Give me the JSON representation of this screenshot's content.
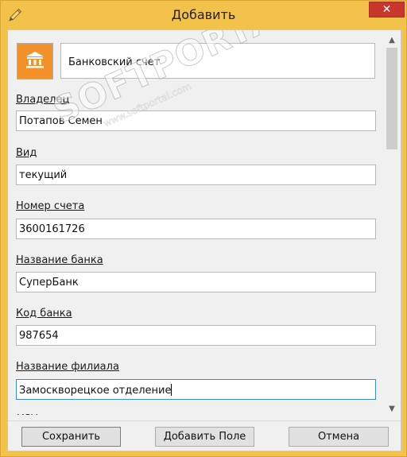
{
  "window": {
    "title": "Добавить",
    "title_icon": "pencil-icon",
    "close_glyph": "✕",
    "accent_color": "#f3c24a",
    "close_color": "#c7372d"
  },
  "record_type": {
    "icon": "bank-icon",
    "icon_color": "#f3912b",
    "name": "Банковский счет"
  },
  "fields": [
    {
      "label": "Владелец",
      "value": "Потапов Семен"
    },
    {
      "label": "Вид",
      "value": "текущий"
    },
    {
      "label": "Номер счета",
      "value": "3600161726"
    },
    {
      "label": "Название банка",
      "value": "СуперБанк"
    },
    {
      "label": "Код банка",
      "value": "987654"
    },
    {
      "label": "Название филиала",
      "value": "Замоскворецкое отделение"
    }
  ],
  "buttons": {
    "save": "Сохранить",
    "add_field": "Добавить Поле",
    "cancel": "Отмена"
  },
  "watermark": {
    "logo": "SOFTPORTAL",
    "url": "www.softportal.com"
  }
}
